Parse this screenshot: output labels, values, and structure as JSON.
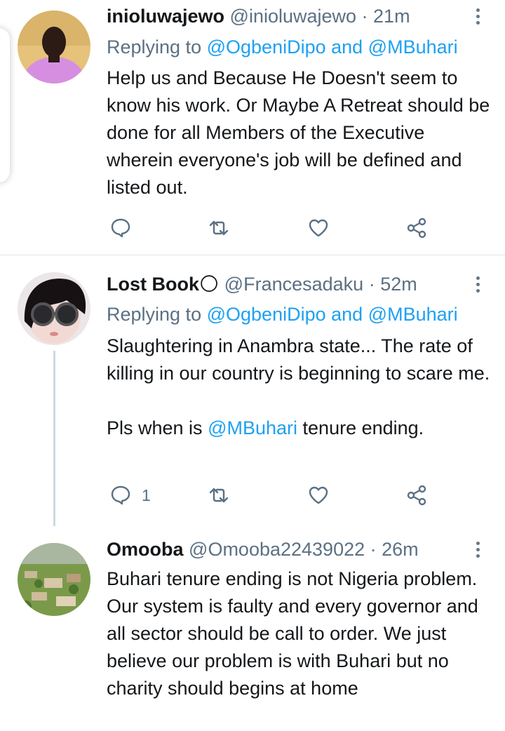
{
  "tweets": [
    {
      "name": "inioluwajewo",
      "handle": "@inioluwajewo",
      "time": "21m",
      "replying_prefix": "Replying to",
      "replying_mentions": "@OgbeniDipo and @MBuhari",
      "body": "Help us and Because He Doesn't seem to know his work. Or Maybe A Retreat should be done for all Members of the Executive wherein everyone's job will be defined and listed out.",
      "reply_count": ""
    },
    {
      "name": "Lost Book",
      "name_emoji": "🌕",
      "handle": "@Francesadaku",
      "time": "52m",
      "replying_prefix": "Replying to",
      "replying_mentions": "@OgbeniDipo and @MBuhari",
      "body_line1": "Slaughtering in Anambra state...  The rate of killing in our country is beginning to scare me.",
      "body_line2_prefix": "Pls when is",
      "body_line2_mention": "@MBuhari",
      "body_line2_suffix": " tenure ending.",
      "reply_count": "1"
    },
    {
      "name": "Omooba",
      "handle": "@Omooba22439022",
      "time": "26m",
      "body": "Buhari tenure ending is not Nigeria problem. Our system is faulty and every governor and all sector should be call to order. We just believe our problem is with Buhari but no charity should begins at home"
    }
  ],
  "separator": " · ",
  "icons": [
    "reply-icon",
    "retweet-icon",
    "like-icon",
    "share-icon",
    "more-icon"
  ],
  "colors": {
    "accent": "#1da1f2",
    "secondary_text": "#5b7083",
    "primary_text": "#14171a"
  }
}
